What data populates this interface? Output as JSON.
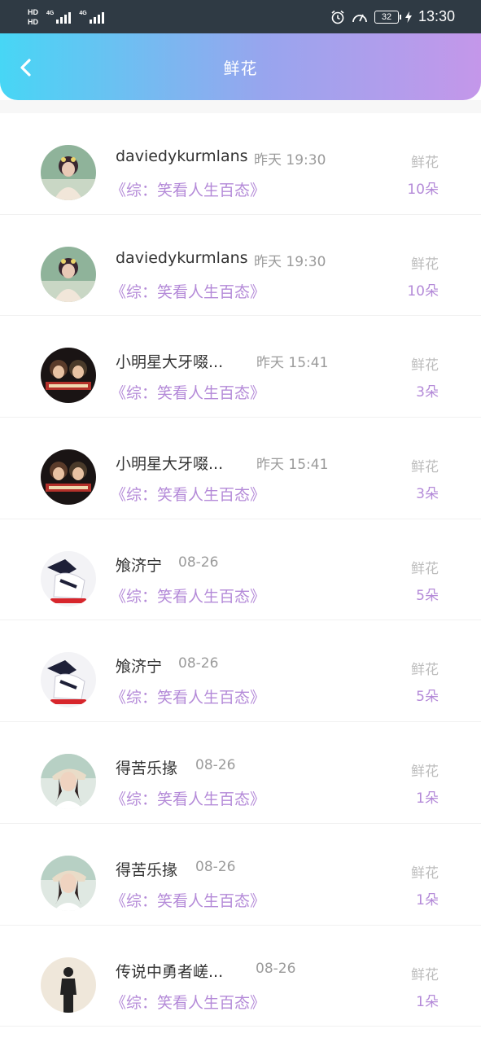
{
  "status_bar": {
    "net_top": "HD",
    "net_bottom": "HD",
    "sig1_label": "4G",
    "sig2_label": "4G",
    "battery": "32",
    "time": "13:30"
  },
  "header": {
    "title": "鲜花"
  },
  "items": [
    {
      "name": "daviedykurmlans",
      "time": "昨天 19:30",
      "show": "《综：笑看人生百态》",
      "gift_label": "鲜花",
      "count": "10朵",
      "avatar": "girl-photo"
    },
    {
      "name": "daviedykurmlans",
      "time": "昨天 19:30",
      "show": "《综：笑看人生百态》",
      "gift_label": "鲜花",
      "count": "10朵",
      "avatar": "girl-photo"
    },
    {
      "name": "小明星大牙啜...",
      "time": "昨天 15:41",
      "show": "《综：笑看人生百态》",
      "gift_label": "鲜花",
      "count": "3朵",
      "avatar": "anime-poster"
    },
    {
      "name": "小明星大牙啜...",
      "time": "昨天 15:41",
      "show": "《综：笑看人生百态》",
      "gift_label": "鲜花",
      "count": "3朵",
      "avatar": "anime-poster"
    },
    {
      "name": "飧济宁",
      "time": "08-26",
      "show": "《综：笑看人生百态》",
      "gift_label": "鲜花",
      "count": "5朵",
      "avatar": "anime-figure"
    },
    {
      "name": "飧济宁",
      "time": "08-26",
      "show": "《综：笑看人生百态》",
      "gift_label": "鲜花",
      "count": "5朵",
      "avatar": "anime-figure"
    },
    {
      "name": "得苦乐掾",
      "time": "08-26",
      "show": "《综：笑看人生百态》",
      "gift_label": "鲜花",
      "count": "1朵",
      "avatar": "woman-photo"
    },
    {
      "name": "得苦乐掾",
      "time": "08-26",
      "show": "《综：笑看人生百态》",
      "gift_label": "鲜花",
      "count": "1朵",
      "avatar": "woman-photo"
    },
    {
      "name": "传说中勇者嵯...",
      "time": "08-26",
      "show": "《综：笑看人生百态》",
      "gift_label": "鲜花",
      "count": "1朵",
      "avatar": "silhouette"
    }
  ]
}
